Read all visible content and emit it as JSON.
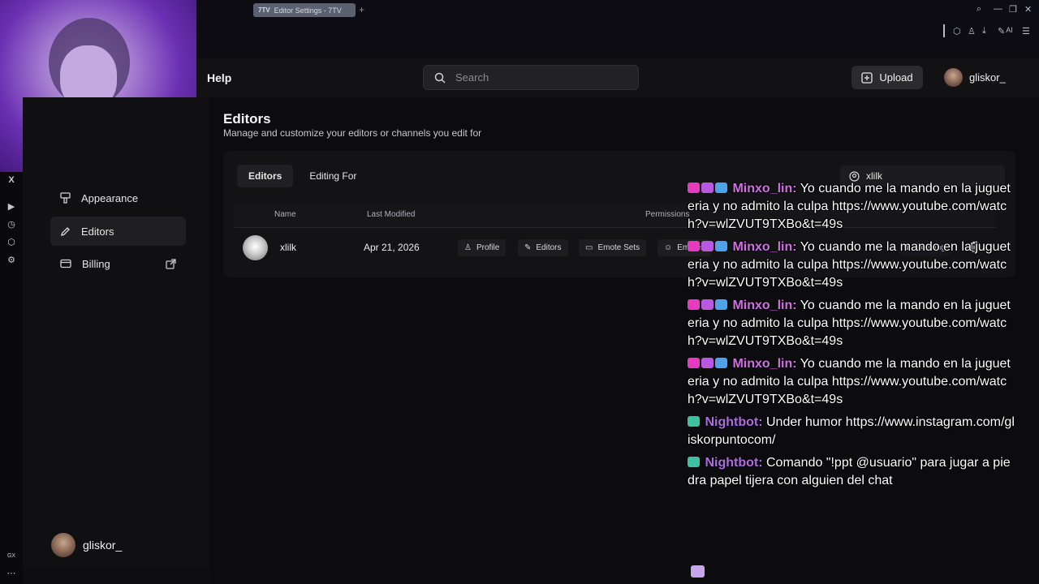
{
  "browser": {
    "tab_title": "Editor Settings - 7TV",
    "tab_favicon": "7TV",
    "new_tab_glyph": "+",
    "ai_label": "AI",
    "side_bottom_label": "GX"
  },
  "header": {
    "help_label": "Help",
    "search_placeholder": "Search",
    "upload_label": "Upload",
    "username": "gliskor_"
  },
  "sidebar": {
    "items": [
      {
        "label": "Appearance",
        "icon": "brush-icon"
      },
      {
        "label": "Editors",
        "icon": "pencil-icon",
        "active": true
      },
      {
        "label": "Billing",
        "icon": "card-icon"
      }
    ],
    "username": "gliskor_"
  },
  "main": {
    "title": "Editors",
    "subtitle": "Manage and customize your editors or channels you edit for",
    "tabs": [
      {
        "label": "Editors",
        "active": true
      },
      {
        "label": "Editing For",
        "active": false
      }
    ],
    "filter_value": "xlilk",
    "table": {
      "headers": [
        "Name",
        "Last Modified",
        "Permissions"
      ],
      "rows": [
        {
          "name": "xlilk",
          "last_modified": "Apr 21, 2026",
          "permissions": [
            "Profile",
            "Editors",
            "Emote Sets",
            "Emotes"
          ],
          "status": "Pending"
        }
      ]
    }
  },
  "chat": {
    "messages": [
      {
        "user": "Minxo_lin:",
        "text": "Yo cuando me la mando en la jugueteria y no admito la culpa https://www.youtube.com/watch?v=wlZVUT9TXBo&t=49s"
      },
      {
        "user": "Minxo_lin:",
        "text": "Yo cuando me la mando en la jugueteria y no admito la culpa https://www.youtube.com/watch?v=wlZVUT9TXBo&t=49s"
      },
      {
        "user": "Minxo_lin:",
        "text": "Yo cuando me la mando en la jugueteria y no admito la culpa https://www.youtube.com/watch?v=wlZVUT9TXBo&t=49s"
      },
      {
        "user": "Minxo_lin:",
        "text": "Yo cuando me la mando en la jugueteria y no admito la culpa https://www.youtube.com/watch?v=wlZVUT9TXBo&t=49s"
      },
      {
        "user": "Nightbot:",
        "text": "Under humor https://www.instagram.com/gliskorpuntocom/"
      },
      {
        "user": "Nightbot:",
        "text": "Comando \"!ppt @usuario\" para jugar a piedra papel tijera con alguien del chat"
      }
    ]
  },
  "colors": {
    "accent_pink": "#d46ee6",
    "bot_purple": "#b06ae8",
    "background": "#0e0e10"
  }
}
